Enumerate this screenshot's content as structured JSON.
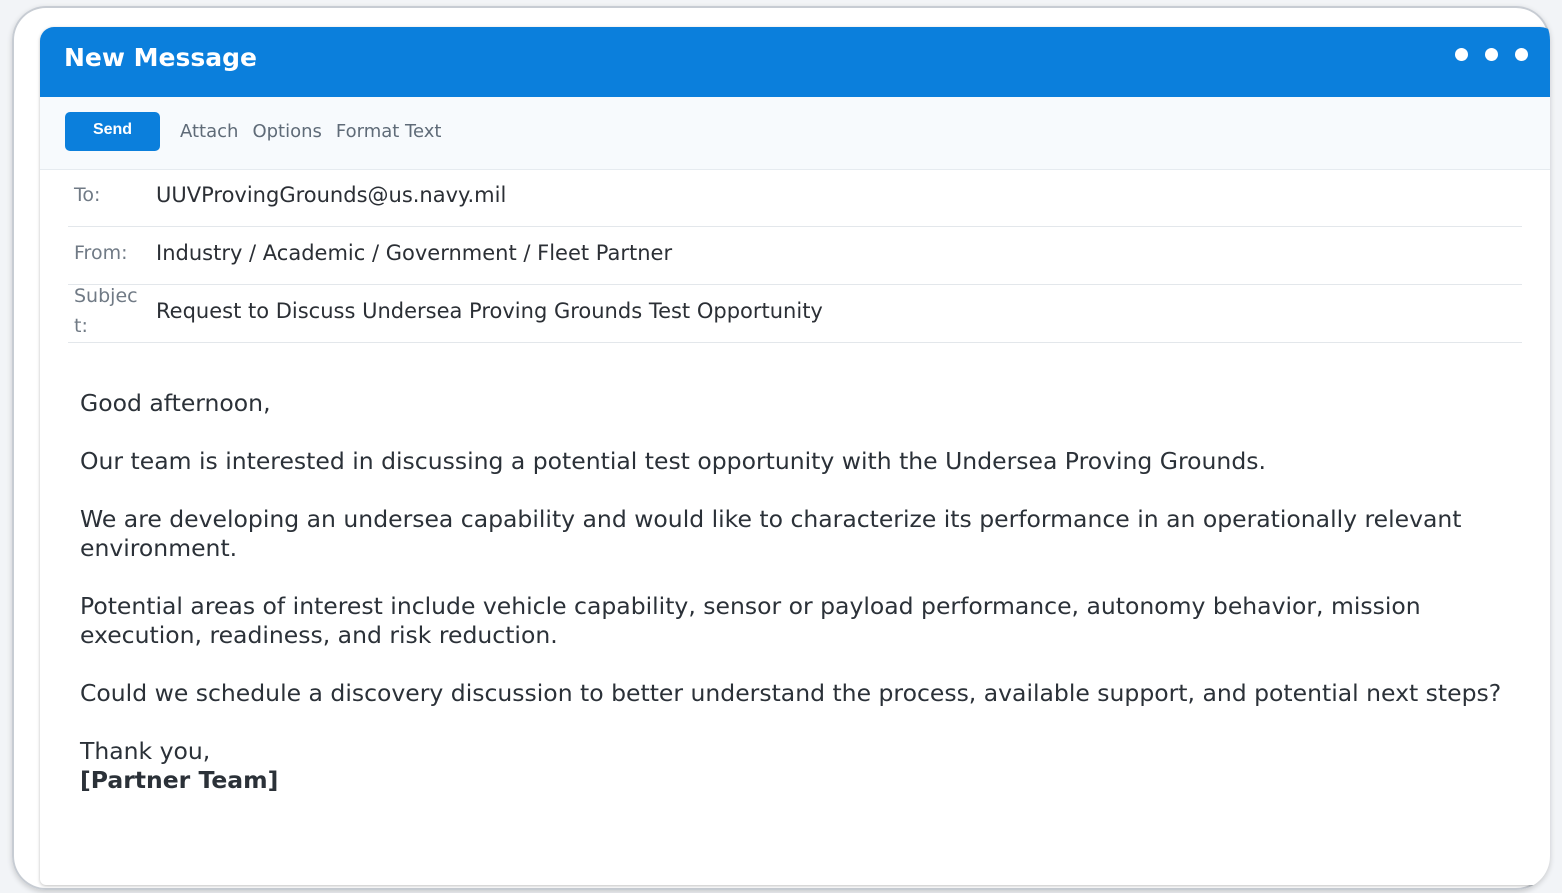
{
  "window": {
    "title": "New Message",
    "menu_icon": "more-dots-icon"
  },
  "toolbar": {
    "send_label": "Send",
    "links": [
      "Attach",
      "Options",
      "Format Text"
    ]
  },
  "fields": {
    "to_label": "To:",
    "to_value": "UUVProvingGrounds@us.navy.mil",
    "from_label": "From:",
    "from_value": "Industry / Academic / Government / Fleet Partner",
    "subject_label": "Subject:",
    "subject_value": "Request to Discuss Undersea Proving Grounds Test Opportunity"
  },
  "body": {
    "greeting": "Good afternoon,",
    "paragraphs": [
      "Our team is interested in discussing a potential test opportunity with the Undersea Proving Grounds.",
      "We are developing an undersea capability and would like to characterize its performance in an operationally relevant environment.",
      "Potential areas of interest include vehicle capability, sensor or payload performance, autonomy behavior, mission execution, readiness, and risk reduction.",
      "Could we schedule a discovery discussion to better understand the process, available support, and potential next steps?"
    ],
    "closing": "Thank you,",
    "signature": "[Partner Team]"
  },
  "colors": {
    "accent": "#0b7fdc",
    "toolbar_bg": "#f7fafd",
    "text": "#2b3138"
  }
}
